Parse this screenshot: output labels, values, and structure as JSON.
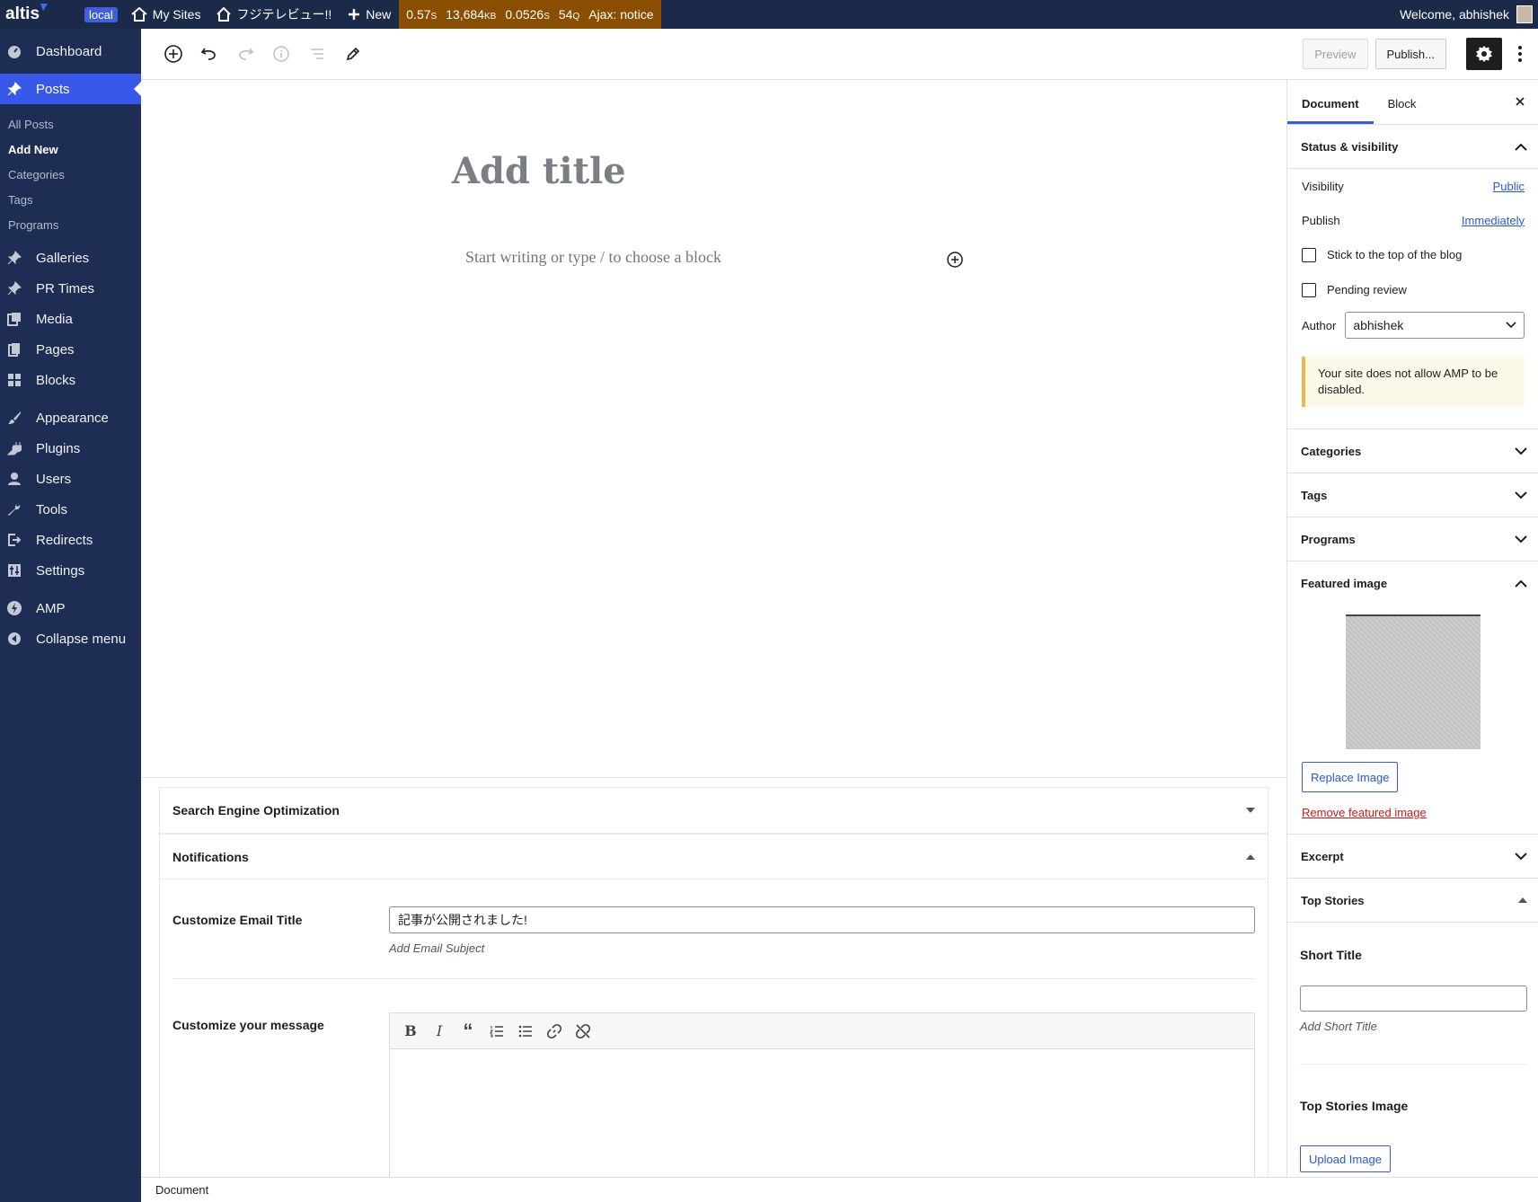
{
  "adminbar": {
    "logo": "altis",
    "environment": "local",
    "my_sites": "My Sites",
    "site_name": "フジテレビュー!!",
    "new": "New",
    "qm": {
      "time": "0.57",
      "time_unit": "S",
      "memory": "13,684",
      "memory_unit": "KB",
      "db_time": "0.0526",
      "db_time_unit": "S",
      "queries": "54",
      "queries_unit": "Q",
      "ajax": "Ajax: notice"
    },
    "welcome": "Welcome, abhishek"
  },
  "sidebar": {
    "dashboard": "Dashboard",
    "posts": "Posts",
    "submenu": [
      "All Posts",
      "Add New",
      "Categories",
      "Tags",
      "Programs"
    ],
    "galleries": "Galleries",
    "pr_times": "PR Times",
    "media": "Media",
    "pages": "Pages",
    "blocks": "Blocks",
    "appearance": "Appearance",
    "plugins": "Plugins",
    "users": "Users",
    "tools": "Tools",
    "redirects": "Redirects",
    "settings": "Settings",
    "amp": "AMP",
    "collapse": "Collapse menu"
  },
  "header": {
    "preview": "Preview",
    "publish": "Publish..."
  },
  "editor": {
    "title_placeholder": "Add title",
    "block_placeholder": "Start writing or type / to choose a block"
  },
  "metaboxes": {
    "seo": "Search Engine Optimization",
    "notifications": "Notifications",
    "email_title_label": "Customize Email Title",
    "email_title_value": "記事が公開されました!",
    "email_title_hint": "Add Email Subject",
    "message_label": "Customize your message"
  },
  "footer": {
    "breadcrumb": "Document"
  },
  "settings": {
    "tabs": {
      "document": "Document",
      "block": "Block"
    },
    "status": {
      "title": "Status & visibility",
      "visibility_label": "Visibility",
      "visibility_value": "Public",
      "publish_label": "Publish",
      "publish_value": "Immediately",
      "sticky": "Stick to the top of the blog",
      "pending": "Pending review",
      "author_label": "Author",
      "author_value": "abhishek",
      "amp_notice": "Your site does not allow AMP to be disabled."
    },
    "categories": "Categories",
    "tags": "Tags",
    "programs": "Programs",
    "featured": {
      "title": "Featured image",
      "replace": "Replace Image",
      "remove": "Remove featured image"
    },
    "excerpt": "Excerpt",
    "top_stories": {
      "title": "Top Stories",
      "short_title_label": "Short Title",
      "short_title_hint": "Add Short Title",
      "image_label": "Top Stories Image",
      "upload": "Upload Image"
    }
  }
}
